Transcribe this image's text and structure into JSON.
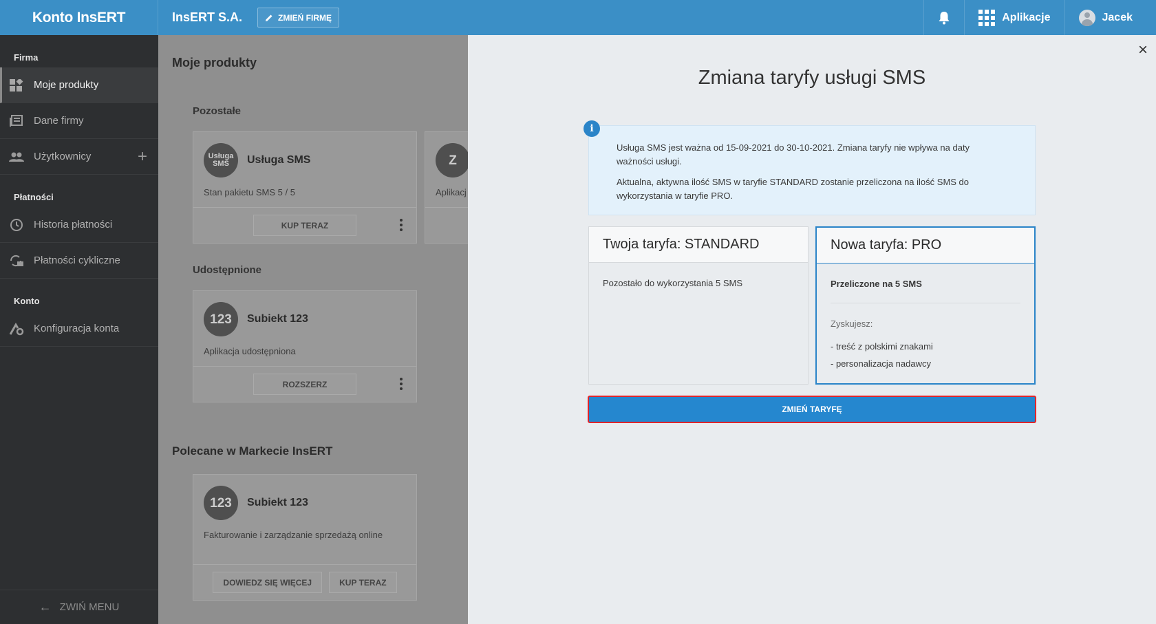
{
  "topbar": {
    "brand": "Konto InsERT",
    "company": "InsERT S.A.",
    "change_company": "ZMIEŃ FIRMĘ",
    "apps": "Aplikacje",
    "user": "Jacek"
  },
  "sidebar": {
    "sections": [
      {
        "label": "Firma",
        "items": [
          {
            "label": "Moje produkty",
            "icon": "products-icon",
            "active": true
          },
          {
            "label": "Dane firmy",
            "icon": "company-data-icon"
          },
          {
            "label": "Użytkownicy",
            "icon": "users-icon",
            "has_add": true
          }
        ]
      },
      {
        "label": "Płatności",
        "items": [
          {
            "label": "Historia płatności",
            "icon": "history-icon"
          },
          {
            "label": "Płatności cykliczne",
            "icon": "recurring-payments-icon"
          }
        ]
      },
      {
        "label": "Konto",
        "items": [
          {
            "label": "Konfiguracja konta",
            "icon": "account-settings-icon"
          }
        ]
      }
    ],
    "collapse": "ZWIŃ MENU"
  },
  "main": {
    "title": "Moje produkty",
    "other_label": "Pozostałe",
    "sms_card": {
      "icon_text": "Usługa SMS",
      "name": "Usługa SMS",
      "desc": "Stan pakietu SMS 5 / 5",
      "button": "KUP TERAZ"
    },
    "z_card": {
      "icon_text": "Z",
      "desc": "Aplikacj"
    },
    "shared_label": "Udostępnione",
    "shared_card": {
      "icon_text": "123",
      "name": "Subiekt 123",
      "desc": "Aplikacja udostępniona",
      "button": "ROZSZERZ"
    },
    "recommended_label": "Polecane w Markecie InsERT",
    "rec_card": {
      "icon_text": "123",
      "name": "Subiekt 123",
      "desc": "Fakturowanie i zarządzanie sprzedażą online",
      "button1": "DOWIEDZ SIĘ WIĘCEJ",
      "button2": "KUP TERAZ"
    }
  },
  "modal": {
    "title": "Zmiana taryfy usługi SMS",
    "info_p1": "Usługa SMS jest ważna od 15-09-2021 do 30-10-2021. Zmiana taryfy nie wpływa na daty ważności usługi.",
    "info_p2": "Aktualna, aktywna ilość SMS w taryfie STANDARD zostanie przeliczona na ilość SMS do wykorzystania w taryfie PRO.",
    "current_plan_title": "Twoja taryfa: STANDARD",
    "current_plan_text": "Pozostało do wykorzystania 5 SMS",
    "new_plan_title": "Nowa taryfa: PRO",
    "new_plan_converted": "Przeliczone na 5 SMS",
    "gain_label": "Zyskujesz:",
    "gains": [
      "- treść z polskimi znakami",
      "- personalizacja nadawcy"
    ],
    "submit": "ZMIEŃ TARYFĘ",
    "close": "×"
  },
  "colors": {
    "brand_blue": "#3b8fc6",
    "button_blue": "#2587cf",
    "highlight_red": "#e0252b"
  }
}
